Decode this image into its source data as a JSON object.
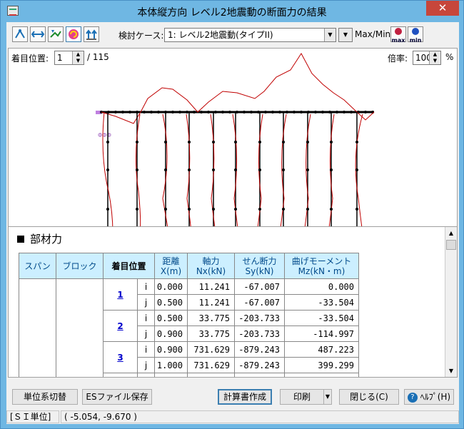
{
  "window": {
    "title": "本体縦方向 レベル2地震動の断面力の結果",
    "close_glyph": "✕"
  },
  "toolbar": {
    "case_label": "検討ケース:",
    "case_value": "1: レベル2地震動(タイプII)",
    "maxmin_label": "Max/Min:",
    "max_btn": "max",
    "min_btn": "min"
  },
  "view": {
    "position_label": "着目位置:",
    "position_value": "1",
    "position_total": "/ 115",
    "scale_label": "倍率:",
    "scale_value": "100",
    "scale_unit": "%"
  },
  "table": {
    "section_title": "部材力",
    "headers": {
      "span": "スパン",
      "block": "ブロック",
      "position": "着目位置",
      "dist": "距離",
      "dist_unit": "X(m)",
      "axial": "軸力",
      "axial_unit": "Nx(kN)",
      "shear": "せん断力",
      "shear_unit": "Sy(kN)",
      "moment": "曲げモーメント",
      "moment_unit": "Mz(kN・m)"
    },
    "groups": [
      {
        "id": "1",
        "rows": [
          {
            "end": "i",
            "x": "0.000",
            "nx": "11.241",
            "sy": "-67.007",
            "mz": "0.000"
          },
          {
            "end": "j",
            "x": "0.500",
            "nx": "11.241",
            "sy": "-67.007",
            "mz": "-33.504"
          }
        ]
      },
      {
        "id": "2",
        "rows": [
          {
            "end": "i",
            "x": "0.500",
            "nx": "33.775",
            "sy": "-203.733",
            "mz": "-33.504"
          },
          {
            "end": "j",
            "x": "0.900",
            "nx": "33.775",
            "sy": "-203.733",
            "mz": "-114.997"
          }
        ]
      },
      {
        "id": "3",
        "rows": [
          {
            "end": "i",
            "x": "0.900",
            "nx": "731.629",
            "sy": "-879.243",
            "mz": "487.223"
          },
          {
            "end": "j",
            "x": "1.000",
            "nx": "731.629",
            "sy": "-879.243",
            "mz": "399.299"
          }
        ]
      }
    ]
  },
  "buttons": {
    "unit_switch": "単位系切替",
    "es_save": "ESファイル保存",
    "report": "計算書作成",
    "print": "印刷",
    "close": "閉じる(C)",
    "help": "ﾍﾙﾌﾟ(H)"
  },
  "status": {
    "unit": "[ＳＩ単位]",
    "coords": "( -5.054, -9.670 )"
  },
  "colors": {
    "diagram_line": "#c00000",
    "frame": "#000000",
    "header_bg": "#ccefff"
  }
}
